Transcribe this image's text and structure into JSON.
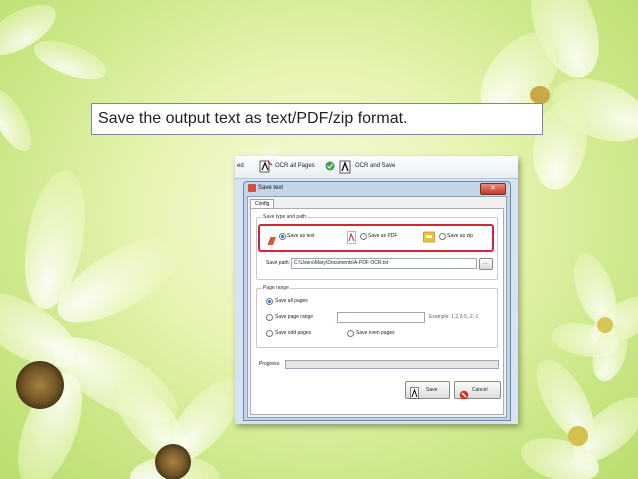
{
  "caption": "Save the output text as text/PDF/zip format.",
  "toolbar": {
    "left_fragment": "ed",
    "ocr_all_pages": "OCR all Pages",
    "ocr_and_save": "OCR and Save"
  },
  "dialog": {
    "title": "Save text",
    "tab": "Config",
    "save_type_group": "Save type and path",
    "options": {
      "text": "Save as text",
      "pdf": "Save as PDF",
      "zip": "Save as zip"
    },
    "save_path_label": "Save path:",
    "save_path_value": "C:\\Users\\Mary\\Documents\\A-PDF OCR.txt",
    "browse_label": "...",
    "page_range_group": "Page range",
    "range": {
      "all": "Save all pages",
      "range": "Save page range",
      "odd": "Save odd pages",
      "even": "Save even pages"
    },
    "example": "Example: 1,2,3-5,-2,-1",
    "progress_label": "Progress:",
    "progress_value": 0,
    "save_button": "Save",
    "cancel_button": "Cancel"
  },
  "colors": {
    "highlight": "#d0263a",
    "bg_green": "#cde88a"
  }
}
